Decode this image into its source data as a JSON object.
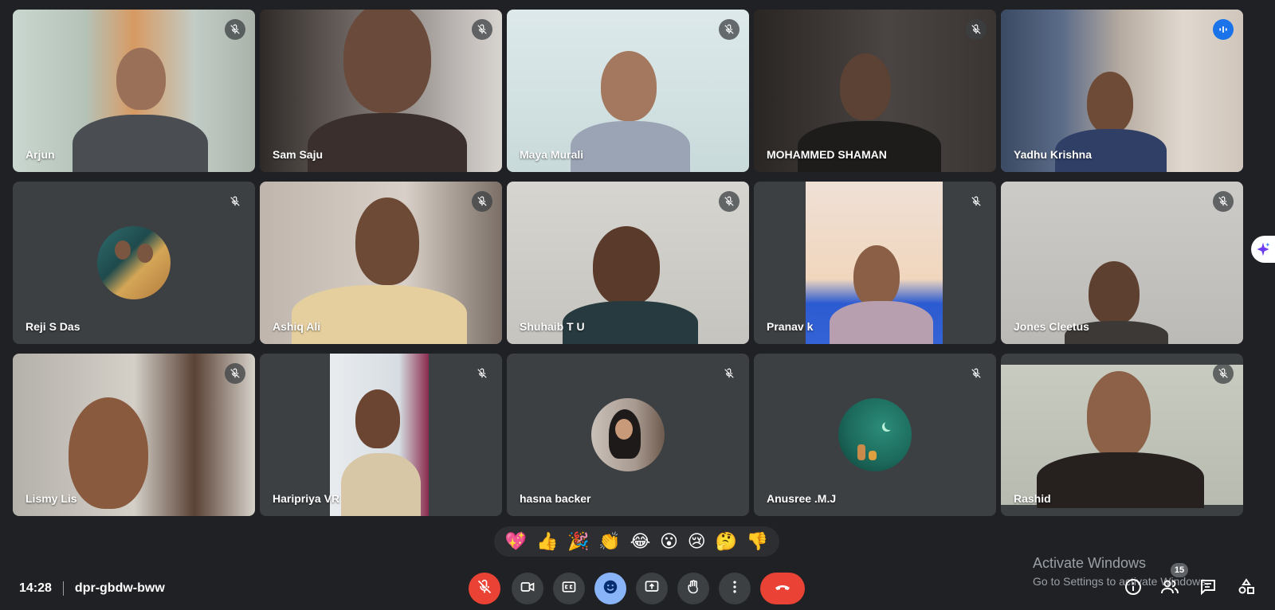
{
  "participants": [
    {
      "name": "Arjun"
    },
    {
      "name": "Sam Saju"
    },
    {
      "name": "Maya Murali"
    },
    {
      "name": "MOHAMMED SHAMAN"
    },
    {
      "name": "Yadhu Krishna"
    },
    {
      "name": "Reji S Das"
    },
    {
      "name": "Ashiq Ali"
    },
    {
      "name": "Shuhaib T U"
    },
    {
      "name": "Pranav k"
    },
    {
      "name": "Jones Cleetus"
    },
    {
      "name": "Lismy Lis"
    },
    {
      "name": "Haripriya VR"
    },
    {
      "name": "hasna backer"
    },
    {
      "name": "Anusree .M.J"
    },
    {
      "name": "Rashid"
    }
  ],
  "reactions": [
    "💖",
    "👍",
    "🎉",
    "👏",
    "😂",
    "😮",
    "😢",
    "🤔",
    "👎"
  ],
  "meeting": {
    "time": "14:28",
    "code": "dpr-gbdw-bww"
  },
  "people_count": "15",
  "activation": {
    "title": "Activate Windows",
    "subtitle": "Go to Settings to activate Windows."
  },
  "colors": {
    "background": "#202124",
    "tile": "#3c4043",
    "end_call": "#ea4335",
    "accent": "#8ab4f8",
    "speaking_border": "#8ab4f8"
  },
  "icons": {
    "tile_muted": "mic-off-icon",
    "tile_speaking": "audio-level-icon",
    "right_rail": "sparkle-icon"
  }
}
